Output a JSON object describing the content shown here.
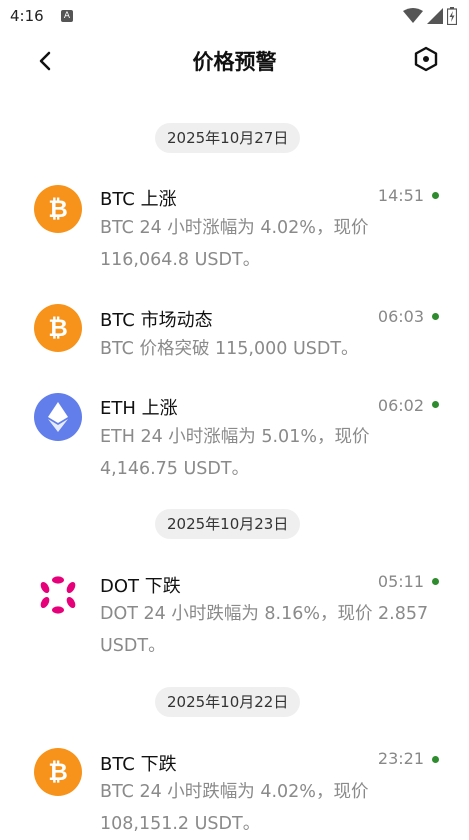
{
  "status": {
    "time": "4:16",
    "badge": "A"
  },
  "header": {
    "title": "价格预警"
  },
  "groups": [
    {
      "date": "2025年10月27日"
    },
    {
      "date": "2025年10月23日"
    },
    {
      "date": "2025年10月22日"
    }
  ],
  "alerts": [
    {
      "icon": "bitcoin-icon",
      "title": "BTC 上涨",
      "time": "14:51",
      "body": "BTC 24 小时涨幅为 4.02%，现价 116,064.8 USDT。"
    },
    {
      "icon": "bitcoin-icon",
      "title": "BTC 市场动态",
      "time": "06:03",
      "body": "BTC 价格突破 115,000 USDT。"
    },
    {
      "icon": "ethereum-icon",
      "title": "ETH 上涨",
      "time": "06:02",
      "body": "ETH 24 小时涨幅为 5.01%，现价 4,146.75 USDT。"
    },
    {
      "icon": "polkadot-icon",
      "title": "DOT 下跌",
      "time": "05:11",
      "body": "DOT 24 小时跌幅为 8.16%，现价 2.857 USDT。"
    },
    {
      "icon": "bitcoin-icon",
      "title": "BTC 下跌",
      "time": "23:21",
      "body": "BTC 24 小时跌幅为 4.02%，现价 108,151.2 USDT。"
    }
  ],
  "colors": {
    "bitcoin": "#f7931a",
    "ethereum": "#627eea",
    "polkadot": "#e6007a",
    "unread": "#2e8b2e"
  }
}
